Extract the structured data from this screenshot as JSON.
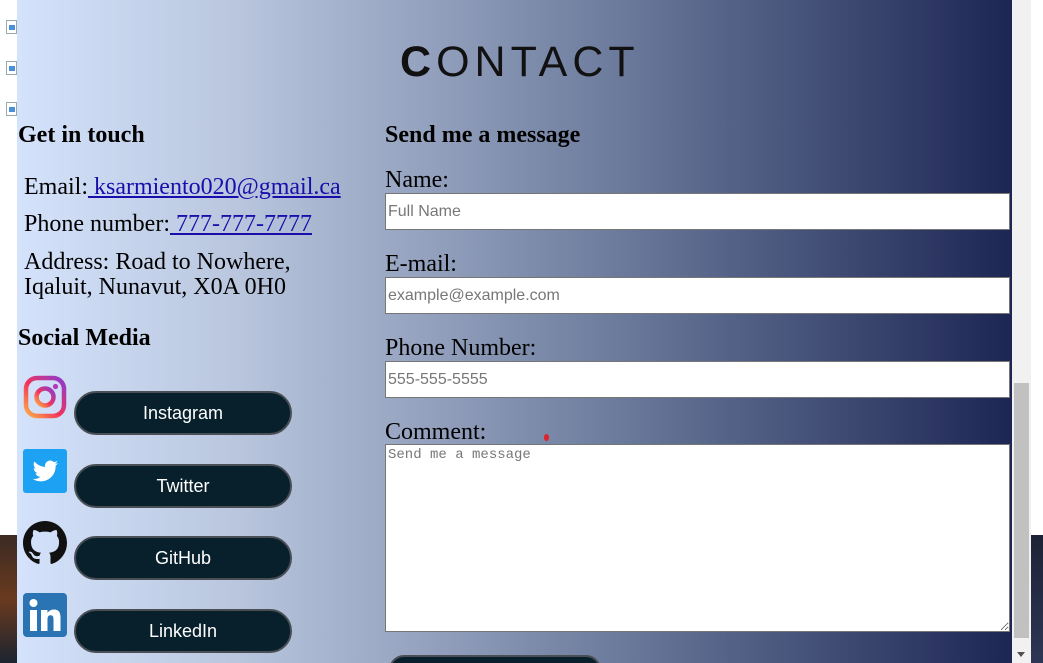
{
  "page": {
    "title_first": "C",
    "title_rest": "ONTACT"
  },
  "contact": {
    "heading": "Get in touch",
    "email_label": "Email:",
    "email_value": " ksarmiento020@gmail.ca",
    "phone_label": "Phone number:",
    "phone_value": " 777-777-7777",
    "address_line1": "Address: Road to Nowhere,",
    "address_line2": "Iqaluit, Nunavut, X0A 0H0"
  },
  "social": {
    "heading": "Social Media",
    "items": [
      {
        "label": "Instagram",
        "icon": "instagram-icon"
      },
      {
        "label": "Twitter",
        "icon": "twitter-icon"
      },
      {
        "label": "GitHub",
        "icon": "github-icon"
      },
      {
        "label": "LinkedIn",
        "icon": "linkedin-icon"
      }
    ]
  },
  "form": {
    "heading": "Send me a message",
    "name_label": "Name:",
    "name_placeholder": "Full Name",
    "email_label": "E-mail:",
    "email_placeholder": "example@example.com",
    "phone_label": "Phone Number:",
    "phone_placeholder": "555-555-5555",
    "comment_label": "Comment:",
    "comment_placeholder": "Send me a message"
  },
  "colors": {
    "button_bg": "#07202b",
    "gradient_start": "#d4e2fb",
    "gradient_end": "#1d2653",
    "link": "#1a0dab"
  }
}
